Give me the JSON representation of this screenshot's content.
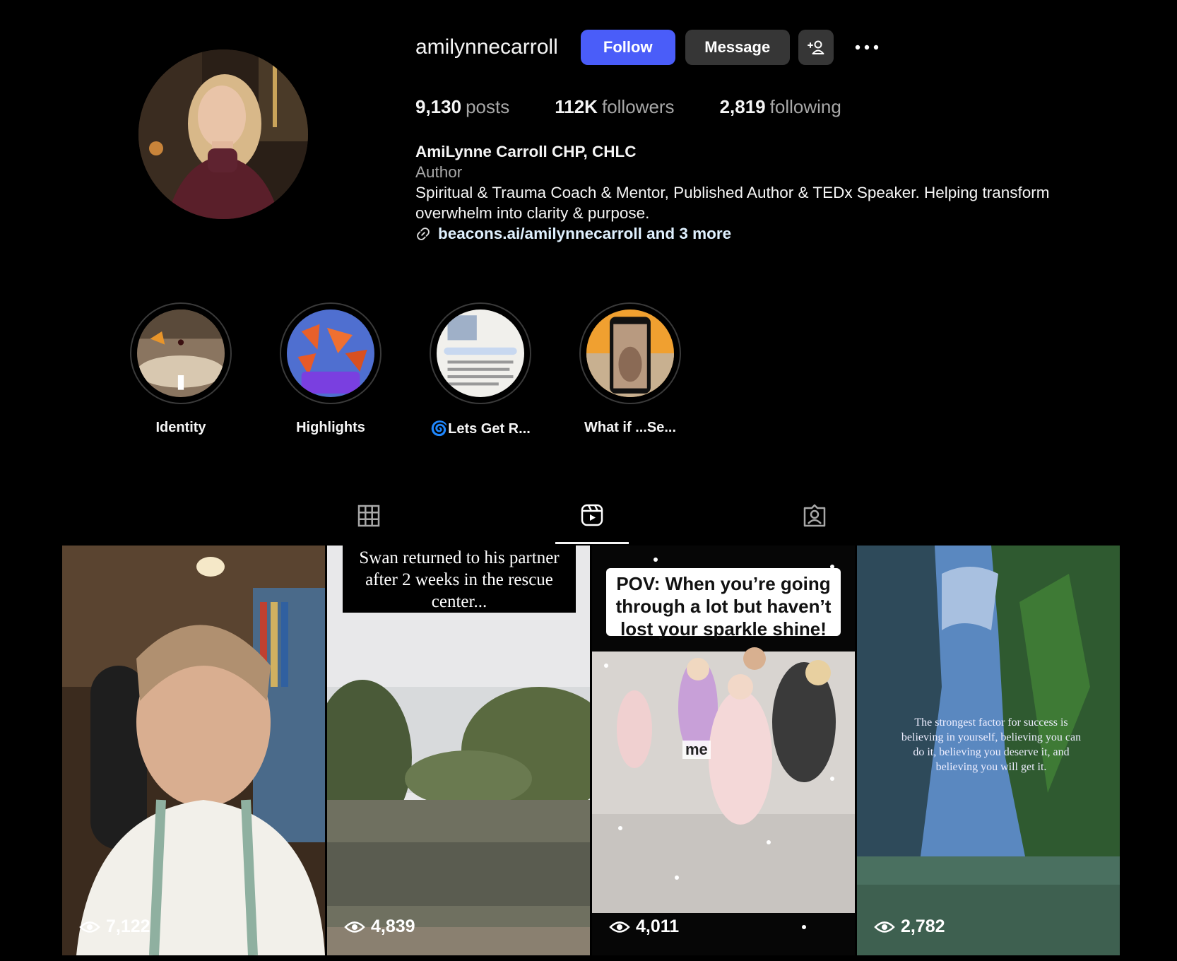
{
  "profile": {
    "username": "amilynnecarroll",
    "follow_label": "Follow",
    "message_label": "Message",
    "add_user_icon": "add-user-icon",
    "more_icon": "more-options-icon"
  },
  "stats": {
    "posts_count": "9,130",
    "posts_label": "posts",
    "followers_count": "112K",
    "followers_label": "followers",
    "following_count": "2,819",
    "following_label": "following"
  },
  "bio": {
    "full_name": "AmiLynne Carroll CHP, CHLC",
    "category": "Author",
    "text": "Spiritual & Trauma Coach & Mentor, Published Author & TEDx Speaker. Helping transform overwhelm into clarity & purpose.",
    "link_text": "beacons.ai/amilynnecarroll and 3 more",
    "link_icon": "link-icon"
  },
  "highlights": [
    {
      "label": "Identity"
    },
    {
      "label": "Highlights"
    },
    {
      "label": "🌀Lets Get R..."
    },
    {
      "label": "What if ...Se..."
    }
  ],
  "tabs": [
    {
      "icon": "grid-icon",
      "active": false
    },
    {
      "icon": "reels-icon",
      "active": true
    },
    {
      "icon": "tagged-icon",
      "active": false
    }
  ],
  "reels": [
    {
      "views": "7,122"
    },
    {
      "views": "4,839",
      "caption": "Swan returned to his partner after 2 weeks in the rescue center..."
    },
    {
      "views": "4,011",
      "caption": "POV: When you’re going through a lot but haven’t lost your sparkle shine!",
      "overlay_label": "me"
    },
    {
      "views": "2,782",
      "caption": "The strongest factor for success is believing in yourself, believing you can do it, believing you deserve it, and believing you will get it."
    }
  ],
  "colors": {
    "background": "#000000",
    "follow_button": "#4a5df9",
    "secondary_button": "#363636",
    "muted_text": "#a8a8a8"
  }
}
